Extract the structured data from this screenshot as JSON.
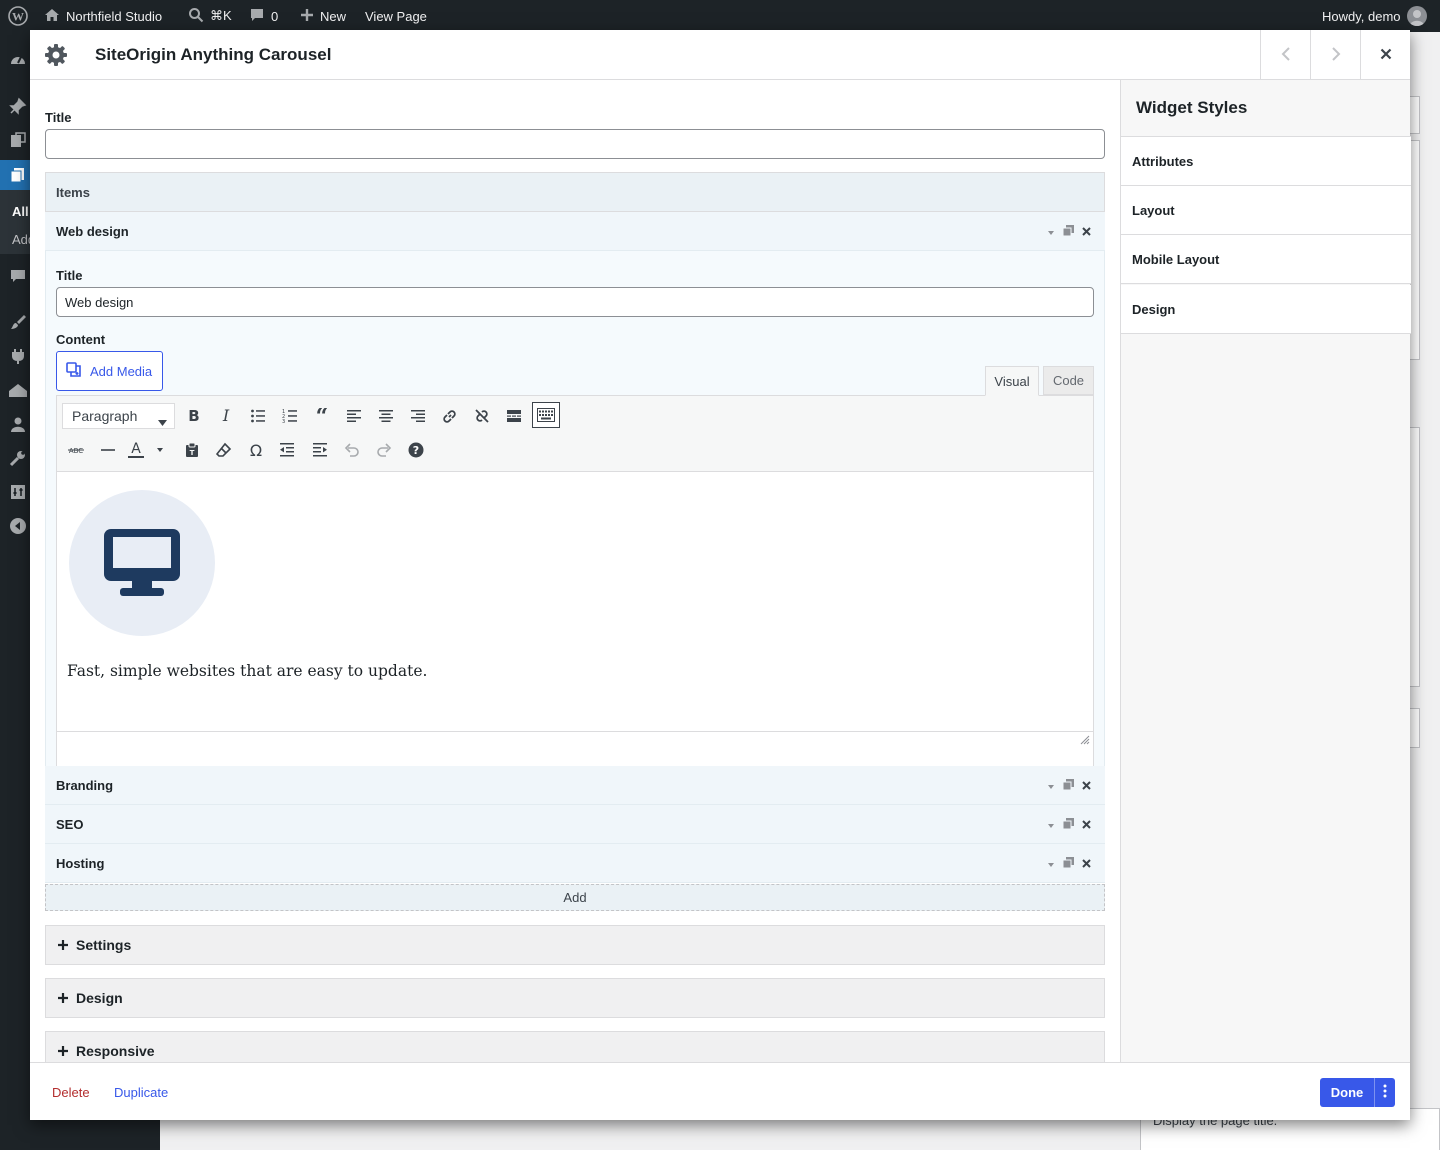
{
  "adminbar": {
    "site_name": "Northfield Studio",
    "search_shortcut": "⌘K",
    "comments_count": "0",
    "new_label": "New",
    "view_page": "View Page",
    "greeting": "Howdy, demo"
  },
  "adminmenu": {
    "sub_all": "All",
    "sub_add": "Add"
  },
  "background": {
    "hint_text": "Display the page title."
  },
  "modal": {
    "title": "SiteOrigin Anything Carousel",
    "fields": {
      "title_label": "Title",
      "title_value": ""
    },
    "items": {
      "label": "Items",
      "expanded": {
        "name": "Web design",
        "title_label": "Title",
        "title_value": "Web design",
        "content_label": "Content",
        "add_media": "Add Media",
        "tab_visual": "Visual",
        "tab_code": "Code",
        "format_select": "Paragraph",
        "editor_text": "Fast, simple websites that are easy to update.",
        "image_icon": "desktop-monitor-icon"
      },
      "collapsed": [
        {
          "name": "Branding"
        },
        {
          "name": "SEO"
        },
        {
          "name": "Hosting"
        }
      ],
      "add_label": "Add"
    },
    "sections": [
      {
        "label": "Settings"
      },
      {
        "label": "Design"
      },
      {
        "label": "Responsive"
      }
    ],
    "sidebar": {
      "heading": "Widget Styles",
      "items": [
        {
          "label": "Attributes"
        },
        {
          "label": "Layout"
        },
        {
          "label": "Mobile Layout"
        },
        {
          "label": "Design"
        }
      ]
    },
    "footer": {
      "delete": "Delete",
      "duplicate": "Duplicate",
      "done": "Done"
    },
    "colors": {
      "primary": "#3858e9",
      "danger": "#b32d2e",
      "icon_bg": "#e8edf5",
      "icon_fg": "#1e3a5f"
    }
  }
}
